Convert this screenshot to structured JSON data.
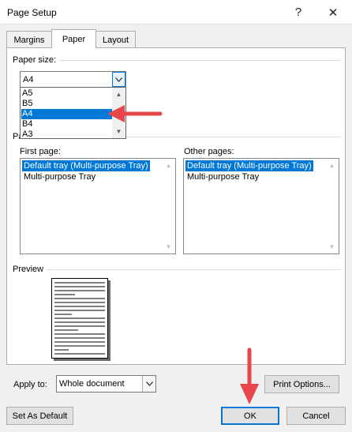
{
  "window": {
    "title": "Page Setup",
    "help": "?",
    "close": "✕"
  },
  "tabs": [
    {
      "label": "Margins"
    },
    {
      "label": "Paper"
    },
    {
      "label": "Layout"
    }
  ],
  "paper_size": {
    "group_label": "Paper size:",
    "selected": "A4",
    "options": [
      "A5",
      "B5",
      "A4",
      "B4",
      "A3"
    ],
    "selected_index": 2
  },
  "paper_source": {
    "group_label_partial": "Pa",
    "first_page": {
      "label": "First page:",
      "items": [
        "Default tray (Multi-purpose Tray)",
        "Multi-purpose Tray"
      ]
    },
    "other_pages": {
      "label": "Other pages:",
      "items": [
        "Default tray (Multi-purpose Tray)",
        "Multi-purpose Tray"
      ]
    }
  },
  "preview": {
    "label": "Preview"
  },
  "apply_to": {
    "label": "Apply to:",
    "value": "Whole document"
  },
  "buttons": {
    "print_options": "Print Options...",
    "set_default": "Set As Default",
    "ok": "OK",
    "cancel": "Cancel"
  },
  "colors": {
    "selection": "#0078d7",
    "annotation_arrow": "#e8464b"
  }
}
